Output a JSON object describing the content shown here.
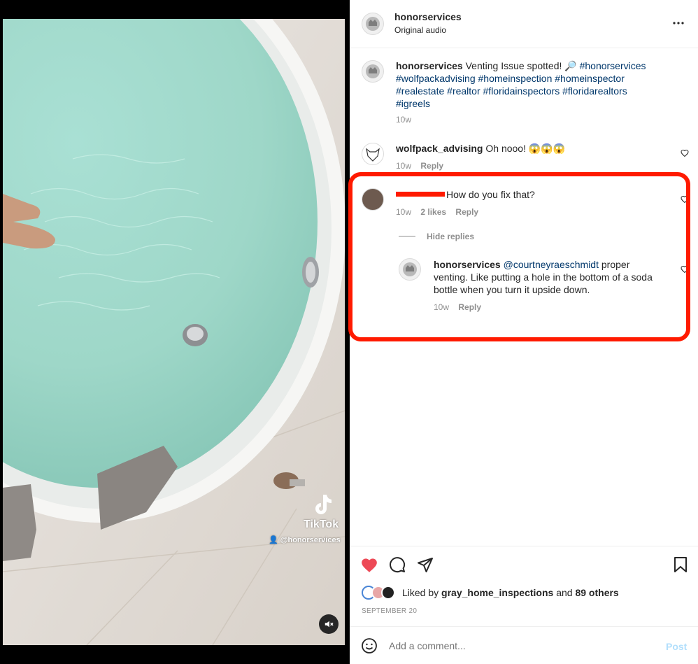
{
  "post": {
    "author": "honorservices",
    "audio": "Original audio",
    "more_icon": "more-horizontal-icon"
  },
  "caption": {
    "username": "honorservices",
    "text": "Venting Issue spotted! 🔎",
    "hashtags_line1": "#honorservices",
    "hashtags_line2": "#wolfpackadvising #homeinspection #homeinspector",
    "hashtags_line3": "#realestate #realtor #floridainspectors #floridarealtors",
    "hashtags_line4": "#igreels",
    "time": "10w"
  },
  "comments": [
    {
      "username": "wolfpack_advising",
      "text": "Oh nooo! 😱😱😱",
      "time": "10w",
      "reply": "Reply"
    },
    {
      "username": "",
      "text": "How do you fix that?",
      "time": "10w",
      "likes": "2 likes",
      "reply": "Reply",
      "hide_replies": "Hide replies"
    }
  ],
  "reply": {
    "username": "honorservices",
    "mention": "@courtneyraeschmidt",
    "text_line1": "proper",
    "text_line2": "venting. Like putting a hole in the bottom of a soda",
    "text_line3": "bottle when you turn it upside down.",
    "time": "10w",
    "reply": "Reply"
  },
  "media": {
    "watermark_brand": "TikTok",
    "watermark_handle": "@honorservices"
  },
  "likes": {
    "prefix": "Liked by",
    "user": "gray_home_inspections",
    "and": "and",
    "count": "89 others"
  },
  "date": "SEPTEMBER 20",
  "comment_input": {
    "placeholder": "Add a comment...",
    "post_label": "Post"
  },
  "colors": {
    "heart_red": "#ed4956",
    "highlight_red": "#ff1a00",
    "hashtag_blue": "#00376b",
    "post_button": "#b2dffc"
  }
}
